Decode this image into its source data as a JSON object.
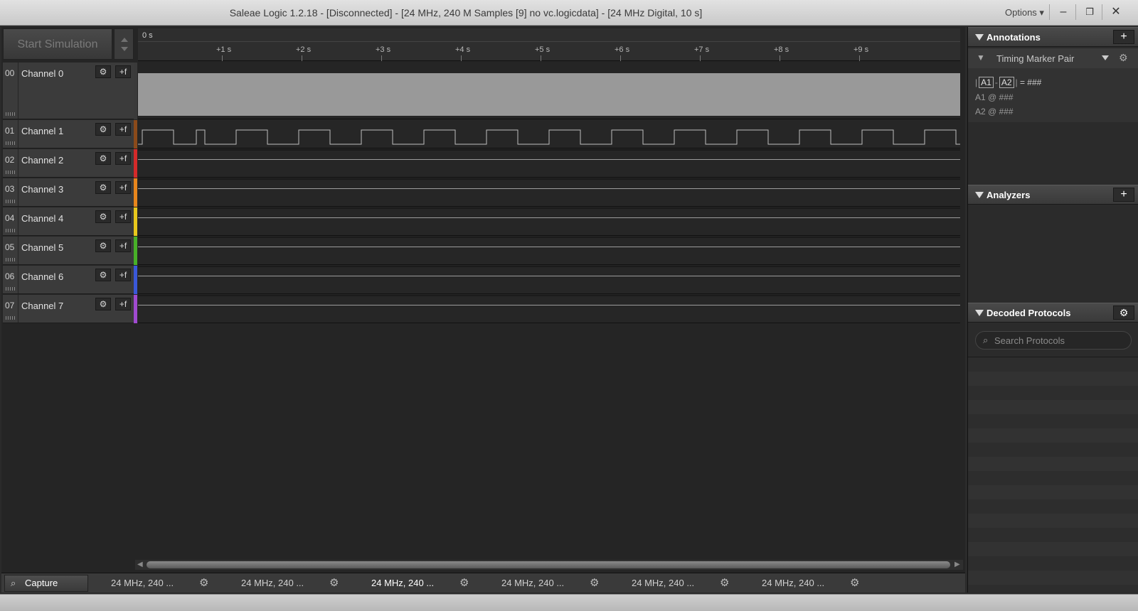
{
  "window": {
    "title": "Saleae Logic 1.2.18 - [Disconnected] - [24 MHz, 240 M Samples [9] no vc.logicdata] - [24 MHz Digital, 10 s]",
    "options_label": "Options ▾",
    "minimize_glyph": "–",
    "restore_glyph": "❐",
    "close_glyph": "✕"
  },
  "toolbar": {
    "start_simulation_label": "Start Simulation"
  },
  "ruler": {
    "zero_label": "0 s",
    "ticks": [
      "+1 s",
      "+2 s",
      "+3 s",
      "+4 s",
      "+5 s",
      "+6 s",
      "+7 s",
      "+8 s",
      "+9 s"
    ]
  },
  "channels": [
    {
      "num": "00",
      "name": "Channel 0",
      "color": "#9a9a9a"
    },
    {
      "num": "01",
      "name": "Channel 1",
      "color": "#8b4a1a"
    },
    {
      "num": "02",
      "name": "Channel 2",
      "color": "#d42a2a"
    },
    {
      "num": "03",
      "name": "Channel 3",
      "color": "#e8861c"
    },
    {
      "num": "04",
      "name": "Channel 4",
      "color": "#e8c81c"
    },
    {
      "num": "05",
      "name": "Channel 5",
      "color": "#48b028"
    },
    {
      "num": "06",
      "name": "Channel 6",
      "color": "#3a58d8"
    },
    {
      "num": "07",
      "name": "Channel 7",
      "color": "#a04ad0"
    }
  ],
  "channel_buttons": {
    "settings_glyph": "⚙",
    "trigger_glyph": "+f"
  },
  "tabs": {
    "capture_label": "Capture",
    "session_labels": [
      "24 MHz, 240 ...",
      "24 MHz, 240 ...",
      "24 MHz, 240 ...",
      "24 MHz, 240 ...",
      "24 MHz, 240 ...",
      "24 MHz, 240 ..."
    ],
    "active_index": 2
  },
  "annotations": {
    "header": "Annotations",
    "add_glyph": "+",
    "marker_label": "Timing Marker Pair",
    "diff_label_a1": "A1",
    "diff_label_a2": "A2",
    "diff_value": "= ###",
    "a1_line": "A1  @  ###",
    "a2_line": "A2  @  ###"
  },
  "analyzers": {
    "header": "Analyzers",
    "add_glyph": "+"
  },
  "decoded_protocols": {
    "header": "Decoded Protocols",
    "settings_glyph": "⚙",
    "search_placeholder": "Search Protocols"
  }
}
